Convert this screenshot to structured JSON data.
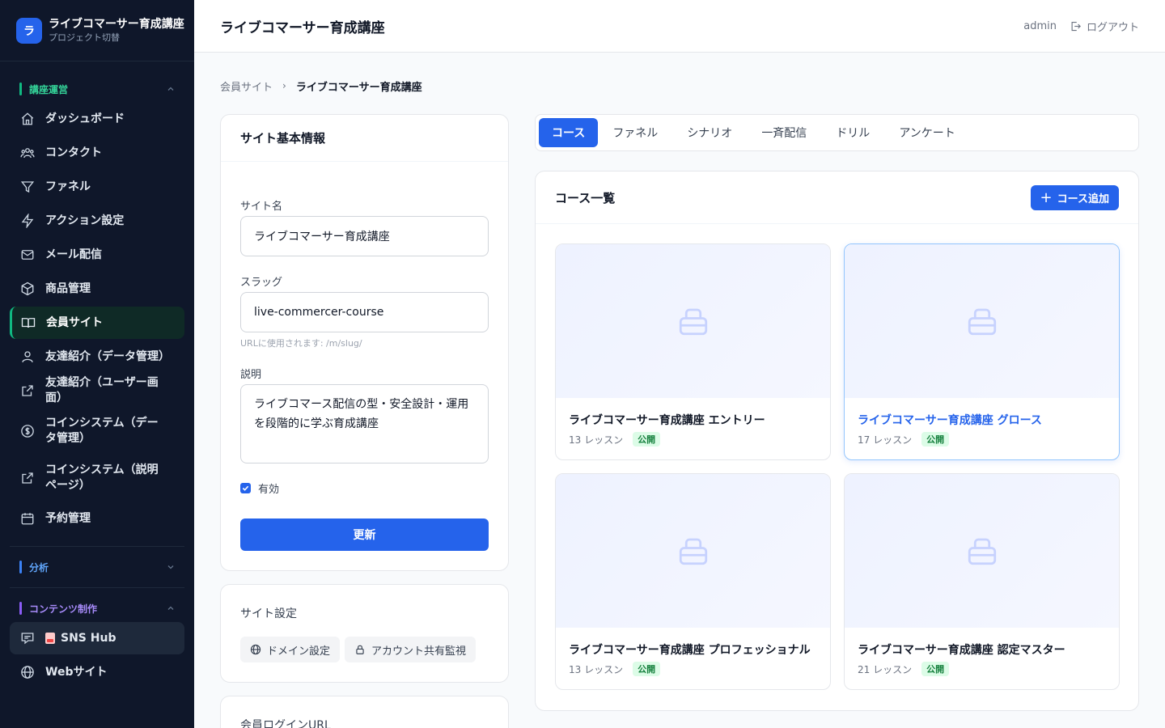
{
  "project": {
    "logo_letter": "ラ",
    "name": "ライブコマーサー育成講座",
    "subtitle": "プロジェクト切替"
  },
  "sidebar": {
    "sections": [
      {
        "label": "講座運営",
        "items": [
          {
            "label": "ダッシュボード",
            "icon": "home-icon"
          },
          {
            "label": "コンタクト",
            "icon": "users-icon"
          },
          {
            "label": "ファネル",
            "icon": "filter-icon"
          },
          {
            "label": "アクション設定",
            "icon": "bolt-icon"
          },
          {
            "label": "メール配信",
            "icon": "mail-icon"
          },
          {
            "label": "商品管理",
            "icon": "box-icon"
          },
          {
            "label": "会員サイト",
            "icon": "book-icon"
          },
          {
            "label": "友達紹介（データ管理）",
            "icon": "user-icon"
          },
          {
            "label": "友達紹介（ユーザー画面）",
            "icon": "external-link-icon"
          },
          {
            "label": "コインシステム（データ管理）",
            "icon": "dollar-icon"
          },
          {
            "label": "コインシステム（説明ページ）",
            "icon": "external-link-icon"
          },
          {
            "label": "予約管理",
            "icon": "calendar-icon"
          }
        ]
      },
      {
        "label": "分析",
        "items": []
      },
      {
        "label": "コンテンツ制作",
        "items": [
          {
            "label": "SNS Hub",
            "icon": "chat-icon"
          },
          {
            "label": "Webサイト",
            "icon": "globe-icon"
          }
        ]
      }
    ]
  },
  "header": {
    "title": "ライブコマーサー育成講座",
    "user": "admin",
    "logout": "ログアウト"
  },
  "breadcrumb": {
    "parent": "会員サイト",
    "sep": "›",
    "current": "ライブコマーサー育成講座"
  },
  "site_info": {
    "title": "サイト基本情報",
    "name_label": "サイト名",
    "name_value": "ライブコマーサー育成講座",
    "slug_label": "スラッグ",
    "slug_value": "live-commercer-course",
    "slug_hint": "URLに使用されます: /m/slug/",
    "desc_label": "説明",
    "desc_value": "ライブコマース配信の型・安全設計・運用を段階的に学ぶ育成講座",
    "enabled_label": "有効",
    "update_button": "更新"
  },
  "site_settings": {
    "title": "サイト設定",
    "domain_button": "ドメイン設定",
    "account_button": "アカウント共有監視"
  },
  "login_url": {
    "title": "会員ログインURL"
  },
  "tabs": [
    "コース",
    "ファネル",
    "シナリオ",
    "一斉配信",
    "ドリル",
    "アンケート"
  ],
  "course_list": {
    "title": "コース一覧",
    "add_button": "コース追加",
    "courses": [
      {
        "title": "ライブコマーサー育成講座 エントリー",
        "lessons": "13 レッスン",
        "status": "公開"
      },
      {
        "title": "ライブコマーサー育成講座 グロース",
        "lessons": "17 レッスン",
        "status": "公開"
      },
      {
        "title": "ライブコマーサー育成講座 プロフェッショナル",
        "lessons": "13 レッスン",
        "status": "公開"
      },
      {
        "title": "ライブコマーサー育成講座 認定マスター",
        "lessons": "21 レッスン",
        "status": "公開"
      }
    ]
  },
  "colors": {
    "primary": "#2563eb",
    "sidebar_bg": "#0f172a",
    "accent_green": "#10b981"
  }
}
